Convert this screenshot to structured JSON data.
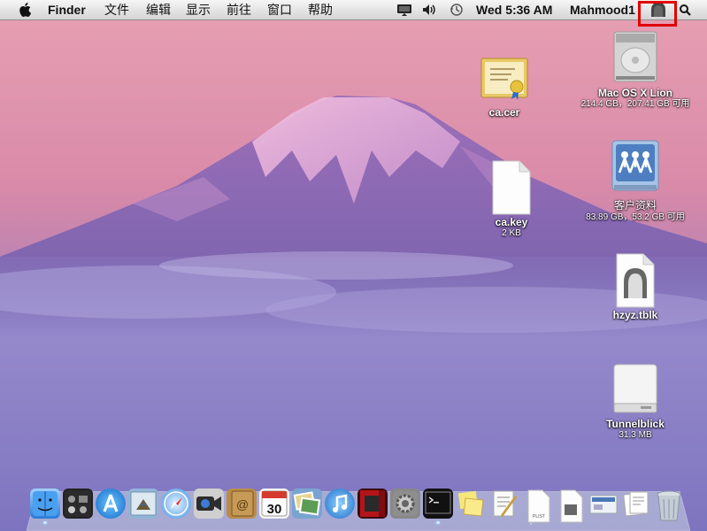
{
  "menubar": {
    "apple_icon": "apple-icon",
    "app_name": "Finder",
    "menus": [
      "文件",
      "编辑",
      "显示",
      "前往",
      "窗口",
      "帮助"
    ],
    "status_icons": [
      "display-icon",
      "volume-icon",
      "time-machine-icon"
    ],
    "clock": "Wed 5:36 AM",
    "user": "Mahmood1",
    "tunnelblick_icon": "tunnelblick-icon",
    "spotlight_icon": "spotlight-search-icon"
  },
  "desktop": {
    "icons": [
      {
        "name": "ca.cer",
        "info": ""
      },
      {
        "name": "ca.key",
        "info": "2 KB"
      },
      {
        "name": "Mac OS X Lion",
        "info": "214.4 GB，207.41 GB 可用"
      },
      {
        "name": "客户资料",
        "info": "83.89 GB，53.2 GB 可用"
      },
      {
        "name": "hzyz.tblk",
        "info": ""
      },
      {
        "name": "Tunnelblick",
        "info": "31.3 MB"
      }
    ]
  },
  "dock": {
    "items": [
      "finder-icon",
      "dashboard-icon",
      "app-store-icon",
      "mail-icon",
      "safari-icon",
      "facetime-icon",
      "address-book-icon",
      "calendar-icon",
      "iphoto-icon",
      "itunes-icon",
      "photo-booth-icon",
      "system-preferences-icon",
      "terminal-icon",
      "stickies-icon",
      "textedit-icon",
      "plist-file-icon",
      "preview-icon",
      "screenshot-icon",
      "document-stack-icon",
      "trash-icon"
    ],
    "calendar_day": "30",
    "plist_label": "PLIST"
  },
  "colors": {
    "sky_top": "#d98aa8",
    "sky_bottom": "#8a7bc0",
    "mountain": "#7a6ab0",
    "highlight": "#e10000"
  }
}
